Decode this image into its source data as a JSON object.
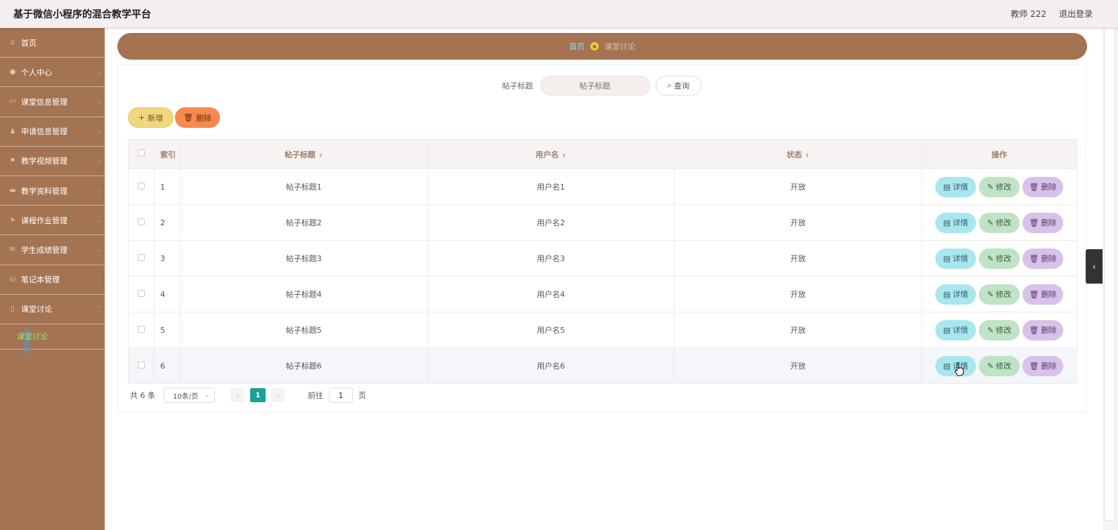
{
  "header": {
    "title": "基于微信小程序的混合教学平台",
    "user": "教师 222",
    "logout": "退出登录"
  },
  "sidebar": {
    "items": [
      {
        "label": "首页",
        "icon": "home-icon"
      },
      {
        "label": "个人中心",
        "icon": "user-icon"
      },
      {
        "label": "课堂信息管理",
        "icon": "monitor-icon"
      },
      {
        "label": "申请信息管理",
        "icon": "person-icon"
      },
      {
        "label": "教学视频管理",
        "icon": "flag-icon"
      },
      {
        "label": "教学资料管理",
        "icon": "doc-icon"
      },
      {
        "label": "课程作业管理",
        "icon": "send-icon"
      },
      {
        "label": "学生成绩管理",
        "icon": "mail-icon"
      },
      {
        "label": "笔记本管理",
        "icon": "db-icon"
      },
      {
        "label": "课堂讨论",
        "icon": "phone-icon"
      }
    ],
    "sub_active": "课堂讨论"
  },
  "breadcrumb": {
    "home": "首页",
    "current": "课堂讨论"
  },
  "search": {
    "label": "帖子标题",
    "placeholder": "帖子标题",
    "button": "查询"
  },
  "toolbar": {
    "add": "新增",
    "delete": "删除"
  },
  "table": {
    "headers": {
      "index": "索引",
      "title": "帖子标题",
      "username": "用户名",
      "status": "状态",
      "ops": "操作"
    },
    "rows": [
      {
        "index": "1",
        "title": "帖子标题1",
        "username": "用户名1",
        "status": "开放"
      },
      {
        "index": "2",
        "title": "帖子标题2",
        "username": "用户名2",
        "status": "开放"
      },
      {
        "index": "3",
        "title": "帖子标题3",
        "username": "用户名3",
        "status": "开放"
      },
      {
        "index": "4",
        "title": "帖子标题4",
        "username": "用户名4",
        "status": "开放"
      },
      {
        "index": "5",
        "title": "帖子标题5",
        "username": "用户名5",
        "status": "开放"
      },
      {
        "index": "6",
        "title": "帖子标题6",
        "username": "用户名6",
        "status": "开放"
      }
    ],
    "op_labels": {
      "detail": "详情",
      "edit": "修改",
      "remove": "删除"
    }
  },
  "pagination": {
    "total": "共 6 条",
    "page_size": "10条/页",
    "current_page": "1",
    "goto_prefix": "前往",
    "goto_value": "1",
    "goto_suffix": "页"
  },
  "colors": {
    "sidebar_bg": "#a47352",
    "accent": "#1aa394",
    "add_button": "#f0d77c",
    "delete_button": "#f88a4e",
    "detail_button": "#a8e7ef",
    "edit_button": "#bfe3c4",
    "remove_button": "#d8c2ea"
  }
}
